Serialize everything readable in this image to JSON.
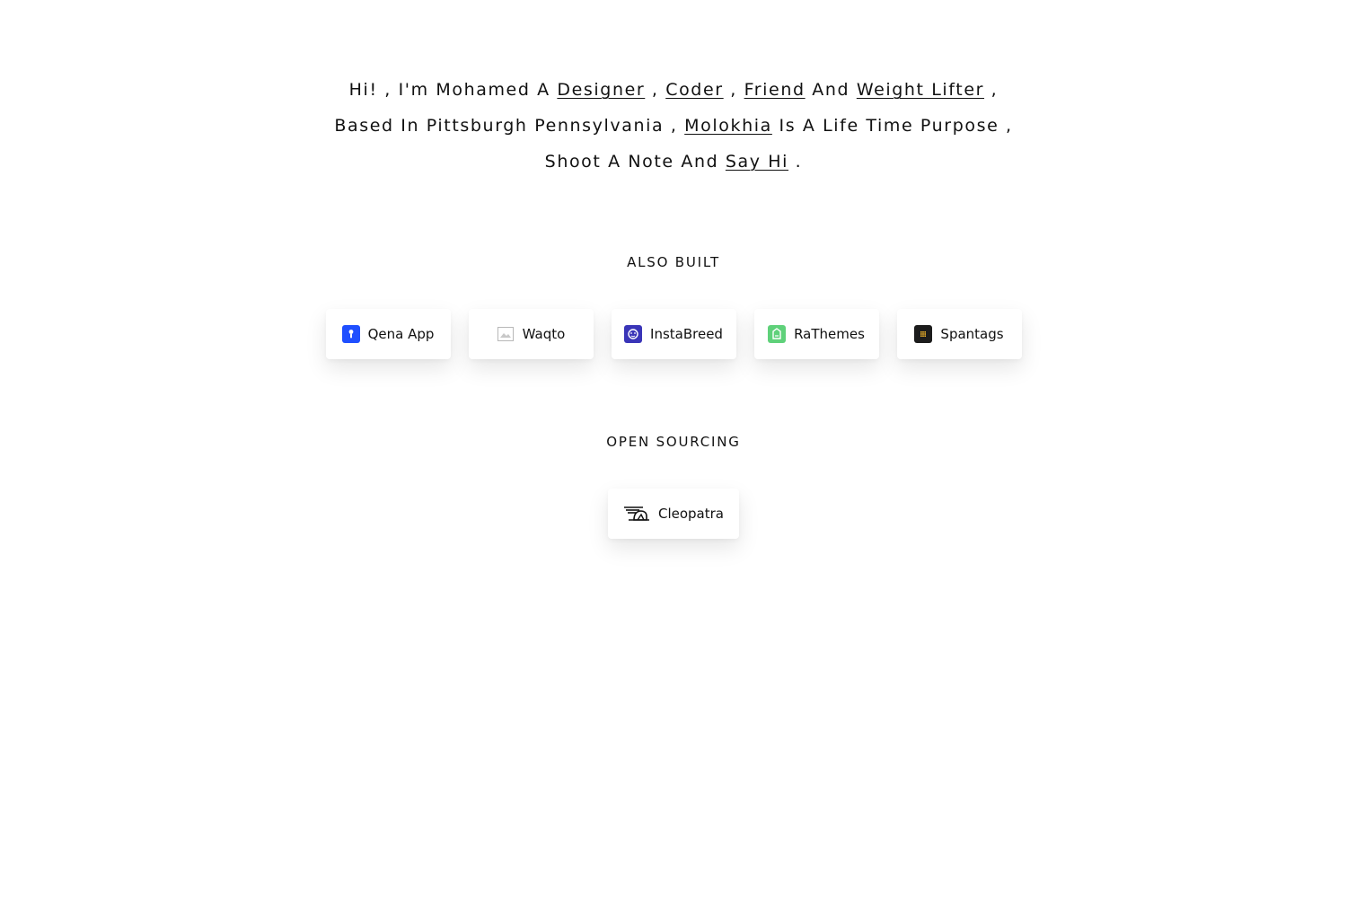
{
  "intro": {
    "line1": {
      "t1": "Hi! , I'm Mohamed A ",
      "link_designer": "Designer",
      "t2": " , ",
      "link_coder": "Coder",
      "t3": " , ",
      "link_friend": "Friend",
      "t4": " And ",
      "link_weight_lifter": "Weight Lifter",
      "t5": " ,"
    },
    "line2": {
      "t1": "Based In Pittsburgh Pennsylvania , ",
      "link_molokhia": "Molokhia",
      "t2": " Is A Life Time Purpose ,"
    },
    "line3": {
      "t1": "Shoot A Note And ",
      "link_say_hi": "Say Hi",
      "t2": " ."
    }
  },
  "also_built": {
    "title": "ALSO BUILT",
    "items": [
      {
        "label": "Qena App",
        "icon": "qena-app-logo-icon",
        "icon_color": "#1f4fff"
      },
      {
        "label": "Waqto",
        "icon": "broken-image-icon",
        "icon_color": "#9e9e9e"
      },
      {
        "label": "InstaBreed",
        "icon": "instabreed-logo-icon",
        "icon_color": "#3a35b8"
      },
      {
        "label": "RaThemes",
        "icon": "rathemes-logo-icon",
        "icon_color": "#5fd17a"
      },
      {
        "label": "Spantags",
        "icon": "spantags-logo-icon",
        "icon_color": "#1c1c1c"
      }
    ]
  },
  "open_sourcing": {
    "title": "OPEN SOURCING",
    "items": [
      {
        "label": "Cleopatra",
        "icon": "cleopatra-logo-icon",
        "icon_color": "#111111"
      }
    ]
  }
}
